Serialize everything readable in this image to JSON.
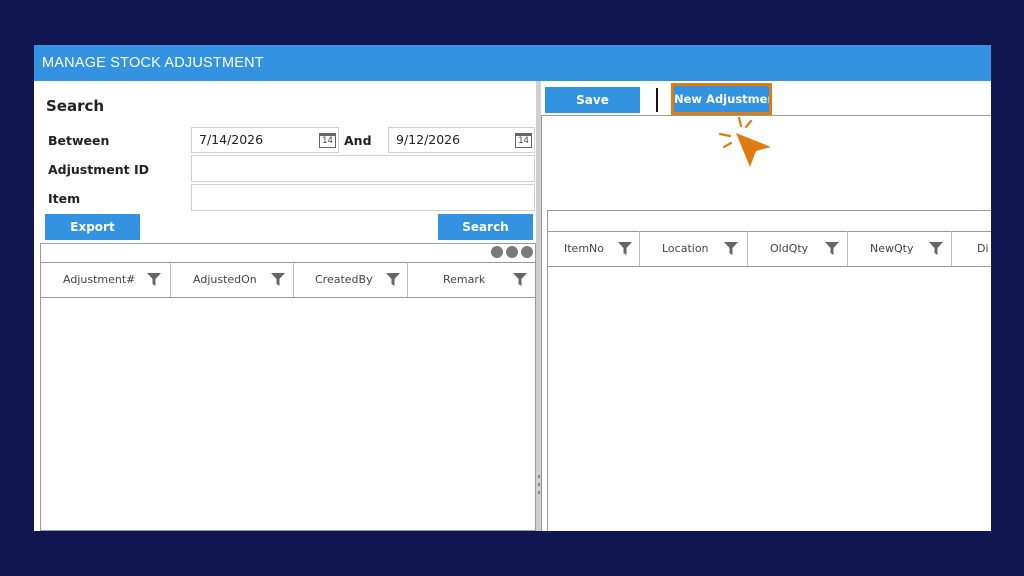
{
  "window": {
    "title": "MANAGE STOCK ADJUSTMENT"
  },
  "search": {
    "heading": "Search",
    "between_label": "Between",
    "from_date": "7/14/2026",
    "and_label": "And",
    "to_date": "9/12/2026",
    "calendar_day": "14",
    "adjustment_id_label": "Adjustment ID",
    "adjustment_id_value": "",
    "item_label": "Item",
    "item_value": "",
    "export_label": "Export",
    "search_label": "Search"
  },
  "left_grid": {
    "columns": [
      "Adjustment#",
      "AdjustedOn",
      "CreatedBy",
      "Remark"
    ]
  },
  "toolbar": {
    "save_label": "Save",
    "new_adjustment_label": "New Adjustment"
  },
  "right_grid": {
    "columns": [
      "ItemNo",
      "Location",
      "OldQty",
      "NewQty",
      "Di"
    ]
  },
  "colors": {
    "background": "#111650",
    "accent": "#3393e0",
    "highlight": "#e07b10"
  },
  "icons": [
    "calendar-icon",
    "filter-icon",
    "cursor-click-icon"
  ]
}
